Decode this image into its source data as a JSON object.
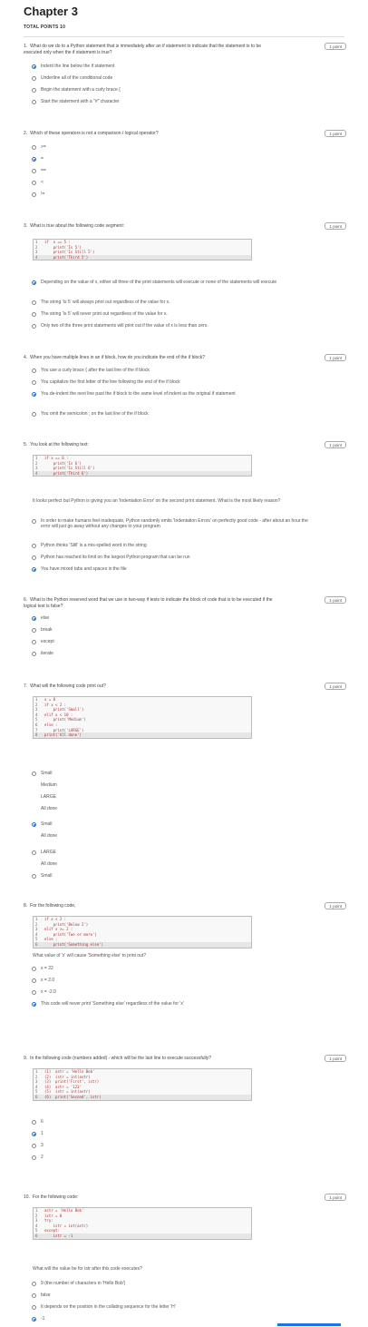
{
  "header": {
    "title": "Chapter 3",
    "total_points": "TOTAL POINTS 10"
  },
  "point_label": "1 point",
  "questions": [
    {
      "num": "1.",
      "text": "What do we do to a Python statement that is immediately after an if statement to indicate that the statement is to be executed only when the if statement is true?",
      "options": [
        "Indent the line below the if statement",
        "Underline all of the conditional code",
        "Begin the statement with a curly brace {",
        "Start the statement with a \"#\" character"
      ],
      "selected": 0
    },
    {
      "num": "2.",
      "text": "Which of these operators is not a comparison / logical operator?",
      "options": [
        ">=",
        "=",
        "==",
        "<",
        "!="
      ],
      "selected": 1
    },
    {
      "num": "3.",
      "text": "What is true about the following code segment:",
      "code": [
        "if  x == 5 :",
        "    print('Is 5')",
        "    print('Is Still 5')",
        "    print('Third 5')"
      ],
      "options": [
        "Depending on the value of x, either all three of the print statements will execute or none of the statements will execute",
        "The string 'Is 5' will always print out regardless of the value for x.",
        "The string 'Is 5' will never print out regardless of the value for x.",
        "Only two of the three print statements will print out if the value of x is less than zero."
      ],
      "selected": 0
    },
    {
      "num": "4.",
      "text": "When you have multiple lines in an if block, how do you indicate the end of the if block?",
      "options": [
        "You use a curly brace { after the last line of the if block",
        "You capitalize the first letter of the line following the end of the if block",
        "You de-indent the next line past the if block to the same level of indent as the original if statement",
        "You omit the semicolon ; on the last line of the if block"
      ],
      "selected": 2
    },
    {
      "num": "5.",
      "text": "You look at the following text:",
      "code": [
        "if x == 6 :",
        "    print('Is 6')",
        "    print('Is Still 6')",
        "    print('Third 6')"
      ],
      "after": "It looks perfect but Python is giving you an 'Indentation Error' on the second print statement. What is the most likely reason?",
      "options": [
        "In order to make humans feel inadequate, Python randomly emits 'Indentation Errors' on perfectly good code - after about an hour the error will just go away without any changes to your program",
        "Python thinks 'Still' is a mis-spelled word in the string",
        "Python has reached its limit on the largest Python program that can be run",
        "You have mixed tabs and spaces in the file"
      ],
      "selected": 3
    },
    {
      "num": "6.",
      "text": "What is the Python reserved word that we use in two-way if tests to indicate the block of code that is to be executed if the logical test is false?",
      "options": [
        "else",
        "break",
        "except",
        "iterate"
      ],
      "selected": 0
    },
    {
      "num": "7.",
      "text": "What will the following code print out?",
      "code": [
        "x = 0",
        "if x < 2 :",
        "    print('Small')",
        "elif x < 10 :",
        "    print('Medium')",
        "else :",
        "    print('LARGE')",
        "print('All done')"
      ],
      "options": [
        "Small\nMedium\nLARGE\nAll done",
        "Small\nAll done",
        "LARGE\nAll done",
        "Small"
      ],
      "selected": 1
    },
    {
      "num": "8.",
      "text": "For the following code,",
      "code": [
        "if x < 2 :",
        "    print('Below 2')",
        "elif x >= 2 :",
        "    print('Two or more')",
        "else :",
        "    print('Something else')"
      ],
      "after": "What value of 'x' will cause 'Something else' to print out?",
      "options": [
        "x = 22",
        "x = 2.0",
        "x = -2.0",
        "This code will never print 'Something else' regardless of the value for 'x'"
      ],
      "selected": 3
    },
    {
      "num": "9.",
      "text": "In the following code (numbers added) - which will be the last line to execute successfully?",
      "code": [
        "(1)  astr = 'Hello Bob'",
        "(2)  istr = int(astr)",
        "(3)  print('First', istr)",
        "(4)  astr = '123'",
        "(5)  istr = int(astr)",
        "(6)  print('Second', istr)"
      ],
      "options": [
        "6",
        "1",
        "3",
        "2"
      ],
      "selected": 1
    },
    {
      "num": "10.",
      "text": "For the following code:",
      "code": [
        "astr = 'Hello Bob'",
        "istr = 0",
        "try:",
        "    istr = int(astr)",
        "except:",
        "    istr = -1"
      ],
      "after": "What will the value be for istr after this code executes?",
      "options": [
        "9 (the number of characters in 'Hello Bob')",
        "false",
        "It depends on the position in the collating sequence for the letter 'H'",
        "-1"
      ],
      "selected": 3
    }
  ]
}
